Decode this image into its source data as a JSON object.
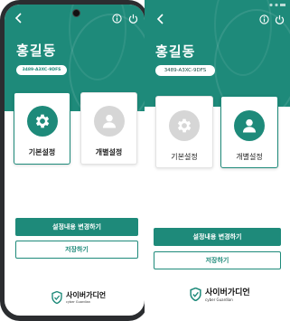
{
  "user": {
    "name": "홍길동",
    "serial": "3489-A3XC-9DFS"
  },
  "cards": {
    "basic": {
      "label": "기본설정",
      "icon": "gear-icon"
    },
    "custom": {
      "label": "개별설정",
      "icon": "person-icon"
    }
  },
  "buttons": {
    "change": "설정내용 변경하기",
    "save": "저장하기"
  },
  "logo": {
    "main": "사이버가디언",
    "sub": "cyber Guardian"
  },
  "colors": {
    "accent": "#1e8a7a",
    "inactive": "#d6d6d6"
  }
}
